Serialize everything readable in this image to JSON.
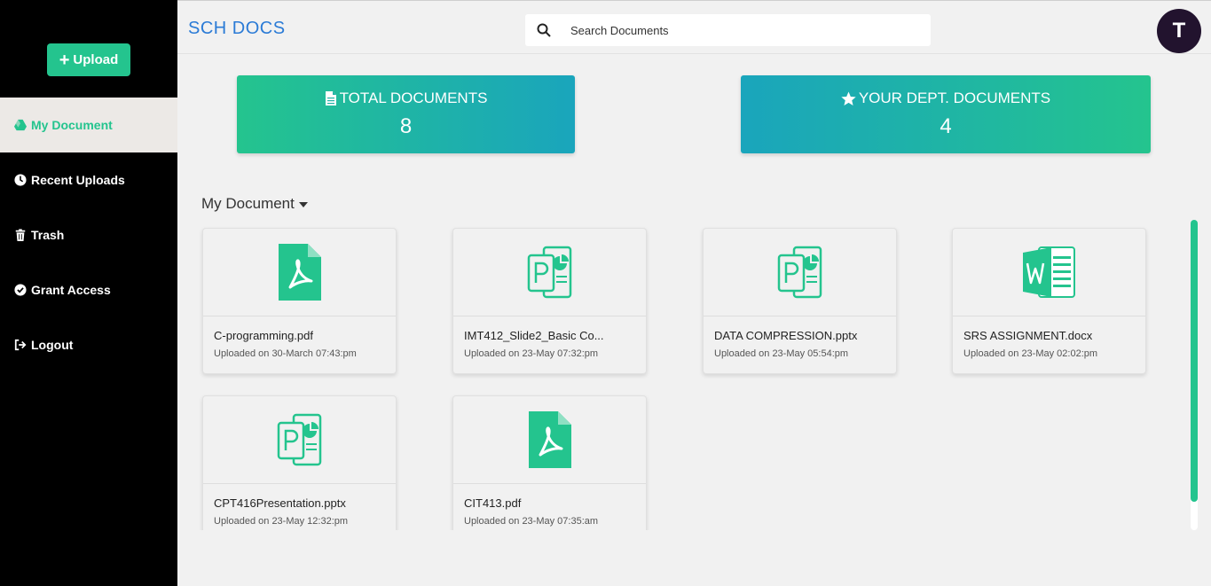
{
  "app": {
    "brand": "SCH DOCS",
    "avatar_letter": "T"
  },
  "search": {
    "placeholder": "Search Documents"
  },
  "sidebar": {
    "upload_label": "Upload",
    "items": [
      {
        "label": "My Document",
        "icon": "drive-icon"
      },
      {
        "label": "Recent Uploads",
        "icon": "clock-icon"
      },
      {
        "label": "Trash",
        "icon": "trash-icon"
      },
      {
        "label": "Grant Access",
        "icon": "check-circle-icon"
      },
      {
        "label": "Logout",
        "icon": "sign-out-icon"
      }
    ]
  },
  "stats": {
    "total": {
      "label": "TOTAL DOCUMENTS",
      "value": "8"
    },
    "dept": {
      "label": "YOUR DEPT. DOCUMENTS",
      "value": "4"
    }
  },
  "section": {
    "title": "My Document"
  },
  "documents": [
    {
      "name": "C-programming.pdf",
      "date": "Uploaded on 30-March 07:43:pm",
      "type": "pdf"
    },
    {
      "name": "IMT412_Slide2_Basic Co...",
      "date": "Uploaded on 23-May 07:32:pm",
      "type": "pptx"
    },
    {
      "name": "DATA COMPRESSION.pptx",
      "date": "Uploaded on 23-May 05:54:pm",
      "type": "pptx"
    },
    {
      "name": "SRS ASSIGNMENT.docx",
      "date": "Uploaded on 23-May 02:02:pm",
      "type": "docx"
    },
    {
      "name": "CPT416Presentation.pptx",
      "date": "Uploaded on 23-May 12:32:pm",
      "type": "pptx"
    },
    {
      "name": "CIT413.pdf",
      "date": "Uploaded on 23-May 07:35:am",
      "type": "pdf"
    }
  ],
  "colors": {
    "accent": "#24c48e",
    "teal": "#1aa5bc",
    "brand": "#2b7bd6",
    "avatar": "#22132e"
  }
}
